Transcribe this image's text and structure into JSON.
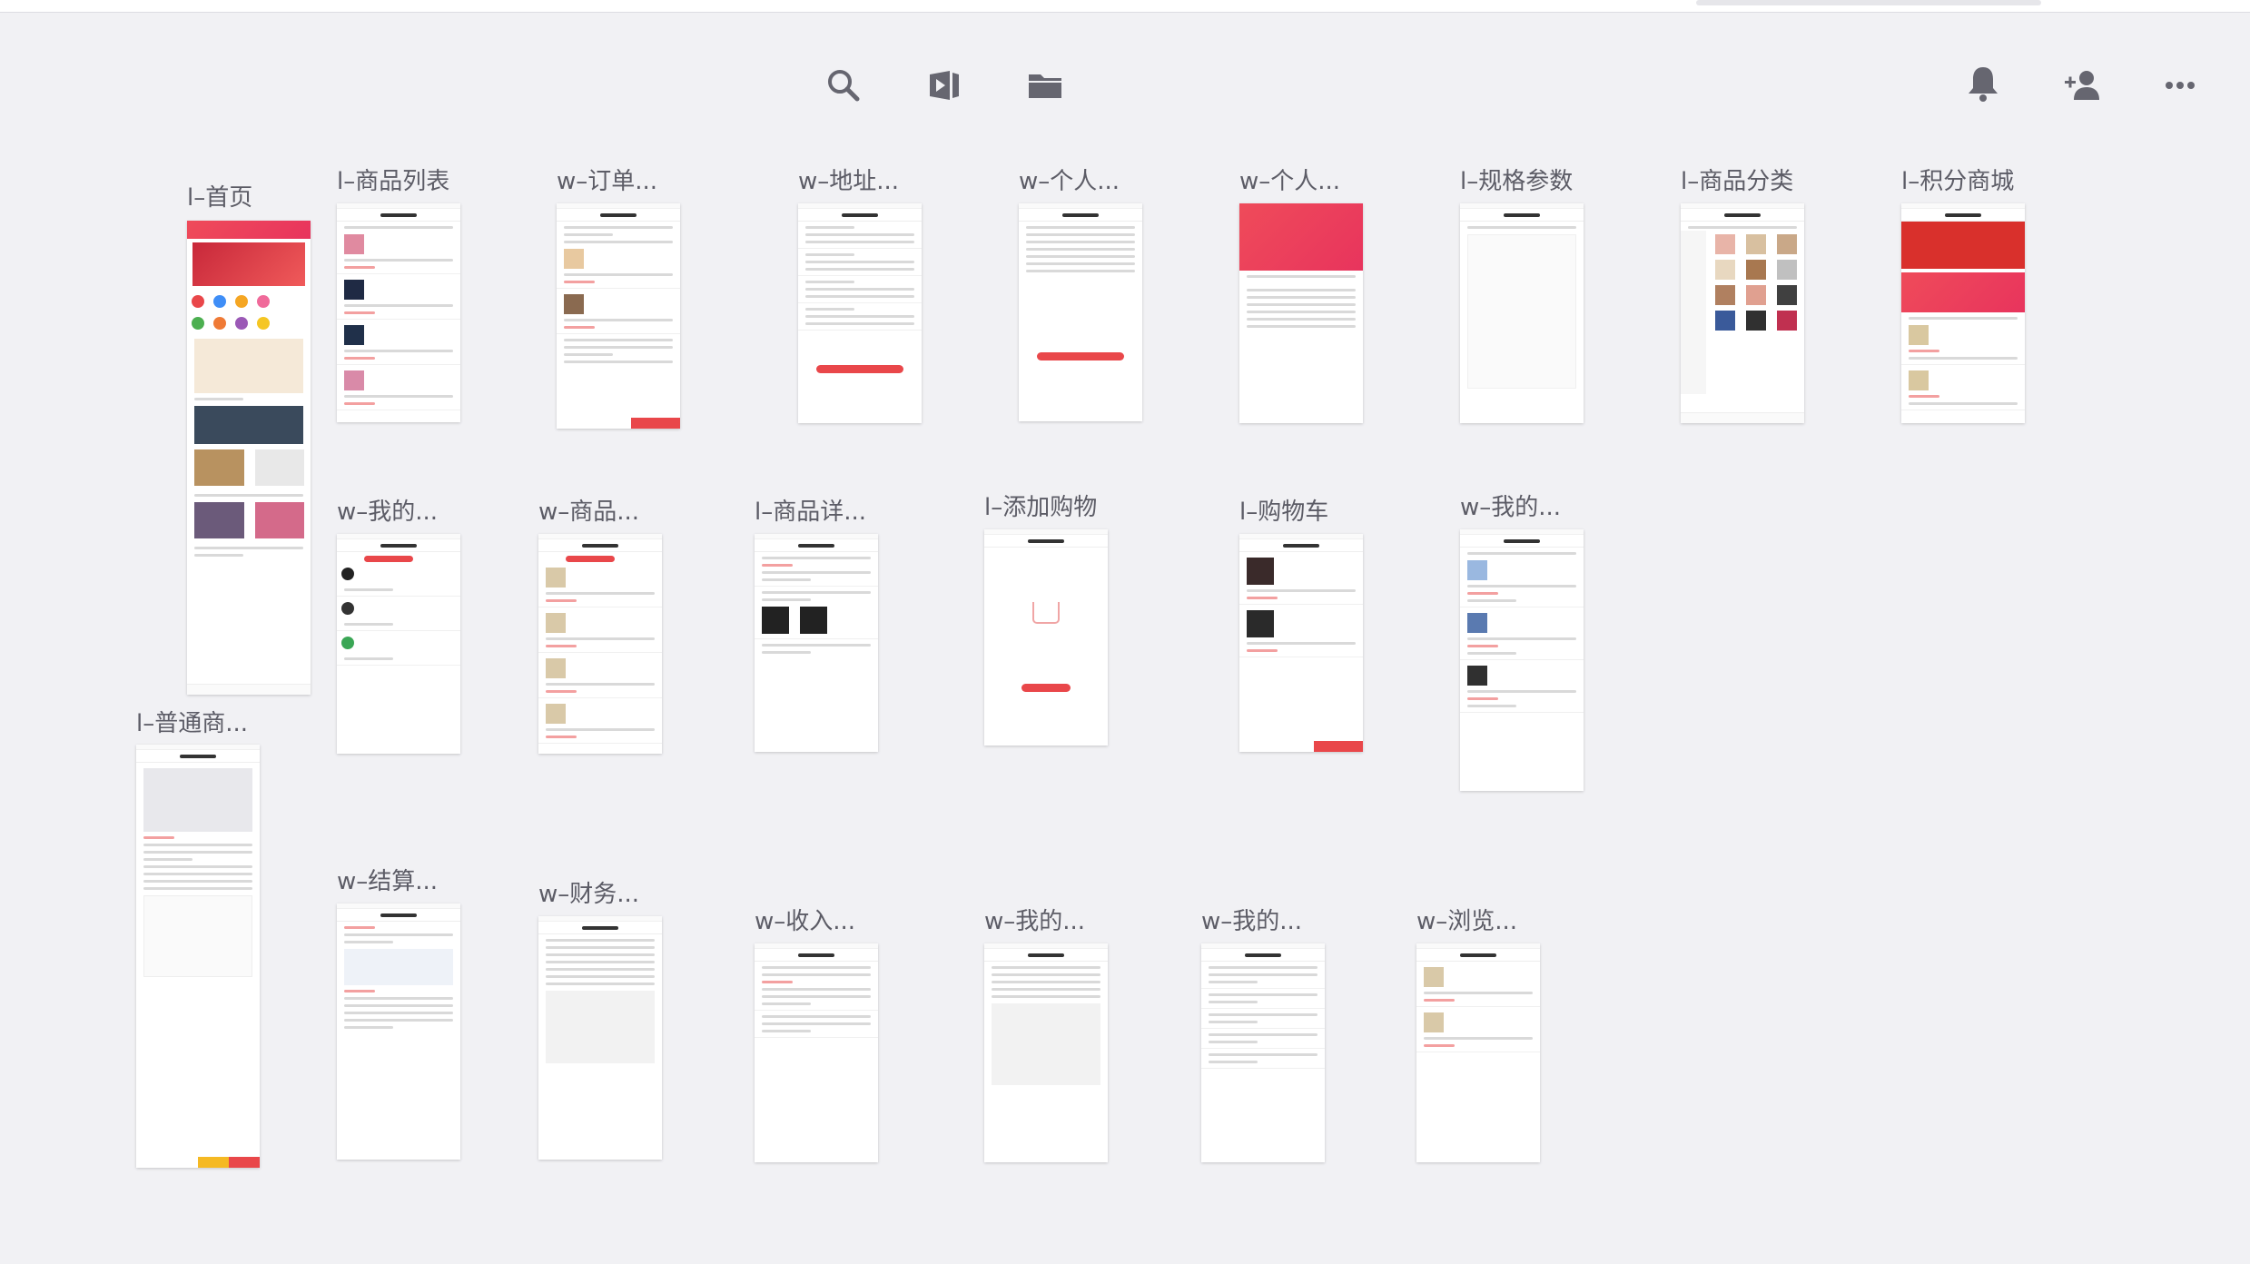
{
  "toolbar": {
    "search_icon": "search-icon",
    "preview_icon": "preview-play-icon",
    "folder_icon": "folder-icon",
    "bell_icon": "bell-icon",
    "add_user_icon": "add-user-icon",
    "more_icon": "more-icon"
  },
  "colors": {
    "background": "#f1f1f4",
    "accent": "#e9474a",
    "icon": "#666670"
  },
  "frames": {
    "home": "l–首页",
    "product_list": "l–商品列表",
    "order": "w–订单...",
    "address": "w–地址...",
    "personal1": "w–个人...",
    "personal2": "w–个人...",
    "spec": "l–规格参数",
    "category": "l–商品分类",
    "points": "l–积分商城",
    "my1": "w–我的...",
    "goods": "w–商品...",
    "product_detail": "l–商品详...",
    "add_cart": "l–添加购物",
    "cart": "l–购物车",
    "my2": "w–我的...",
    "normal_goods": "l–普通商...",
    "settle": "w–结算...",
    "finance": "w–财务...",
    "income": "w–收入...",
    "my3": "w–我的...",
    "my4": "w–我的...",
    "browse": "w–浏览..."
  }
}
